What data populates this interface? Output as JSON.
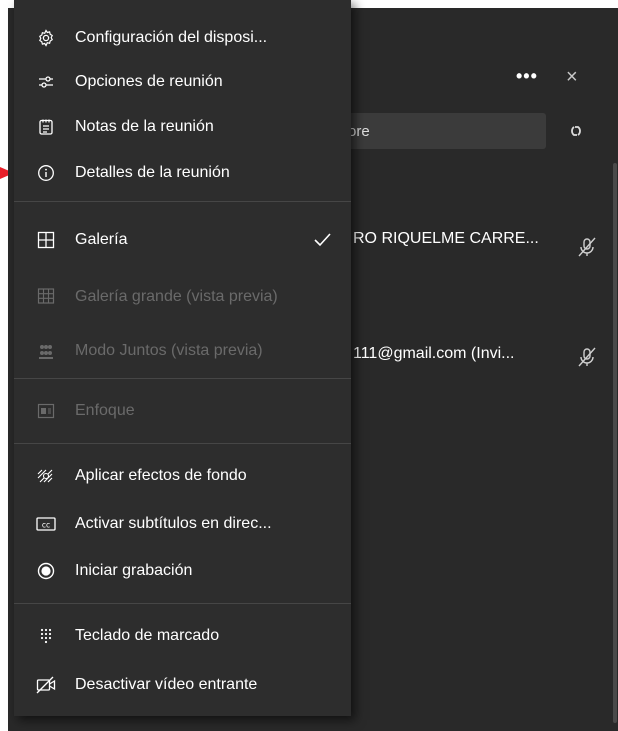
{
  "panel": {
    "more_label": "•••",
    "close_label": "×",
    "search_value": "ore",
    "participants": [
      {
        "name": "RO RIQUELME CARRE..."
      },
      {
        "name": "111@gmail.com (Invi..."
      }
    ]
  },
  "menu": {
    "items": [
      {
        "label": "Configuración del disposi...",
        "icon": "gear-icon"
      },
      {
        "label": "Opciones de reunión",
        "icon": "sliders-icon"
      },
      {
        "label": "Notas de la reunión",
        "icon": "notes-icon"
      },
      {
        "label": "Detalles de la reunión",
        "icon": "info-icon"
      },
      {
        "label": "Galería",
        "icon": "grid-icon"
      },
      {
        "label": "Galería grande (vista previa)",
        "icon": "large-grid-icon"
      },
      {
        "label": "Modo Juntos (vista previa)",
        "icon": "together-icon"
      },
      {
        "label": "Enfoque",
        "icon": "focus-icon"
      },
      {
        "label": "Aplicar efectos de fondo",
        "icon": "background-effects-icon"
      },
      {
        "label": "Activar subtítulos en direc...",
        "icon": "captions-icon"
      },
      {
        "label": "Iniciar grabación",
        "icon": "record-icon"
      },
      {
        "label": "Teclado de marcado",
        "icon": "dialpad-icon"
      },
      {
        "label": "Desactivar vídeo entrante",
        "icon": "video-off-icon"
      }
    ]
  },
  "colors": {
    "menu_bg": "#2d2d2d",
    "panel_bg": "#292929",
    "text": "#ffffff",
    "disabled_text": "#6a6a6a",
    "arrow": "#e8202a"
  }
}
